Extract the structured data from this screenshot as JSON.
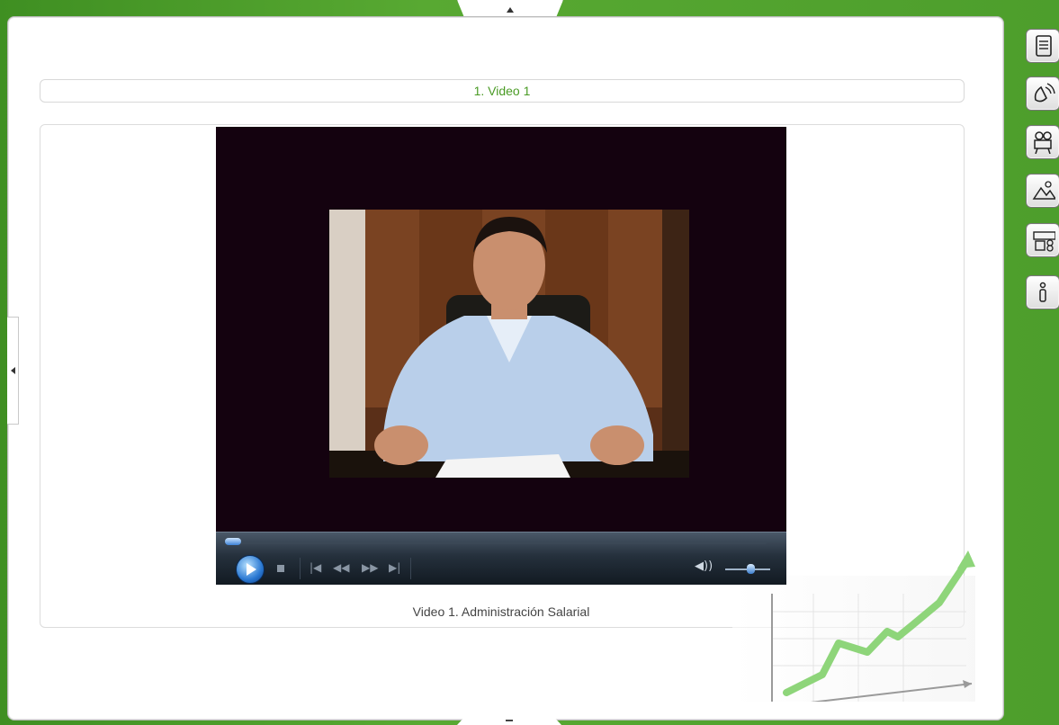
{
  "section": {
    "title": "1. Video 1"
  },
  "video": {
    "caption": "Video 1. Administración Salarial",
    "progress_fraction": 0.0,
    "volume_fraction": 0.55
  },
  "sidebar": {
    "buttons": [
      {
        "icon": "document-icon"
      },
      {
        "icon": "audio-icon"
      },
      {
        "icon": "video-camera-icon"
      },
      {
        "icon": "image-icon"
      },
      {
        "icon": "gamepad-icon"
      },
      {
        "icon": "info-icon"
      }
    ]
  },
  "colors": {
    "background": "#4d9e2c",
    "title_text": "#4a9b25",
    "player_background": "#14020f"
  }
}
